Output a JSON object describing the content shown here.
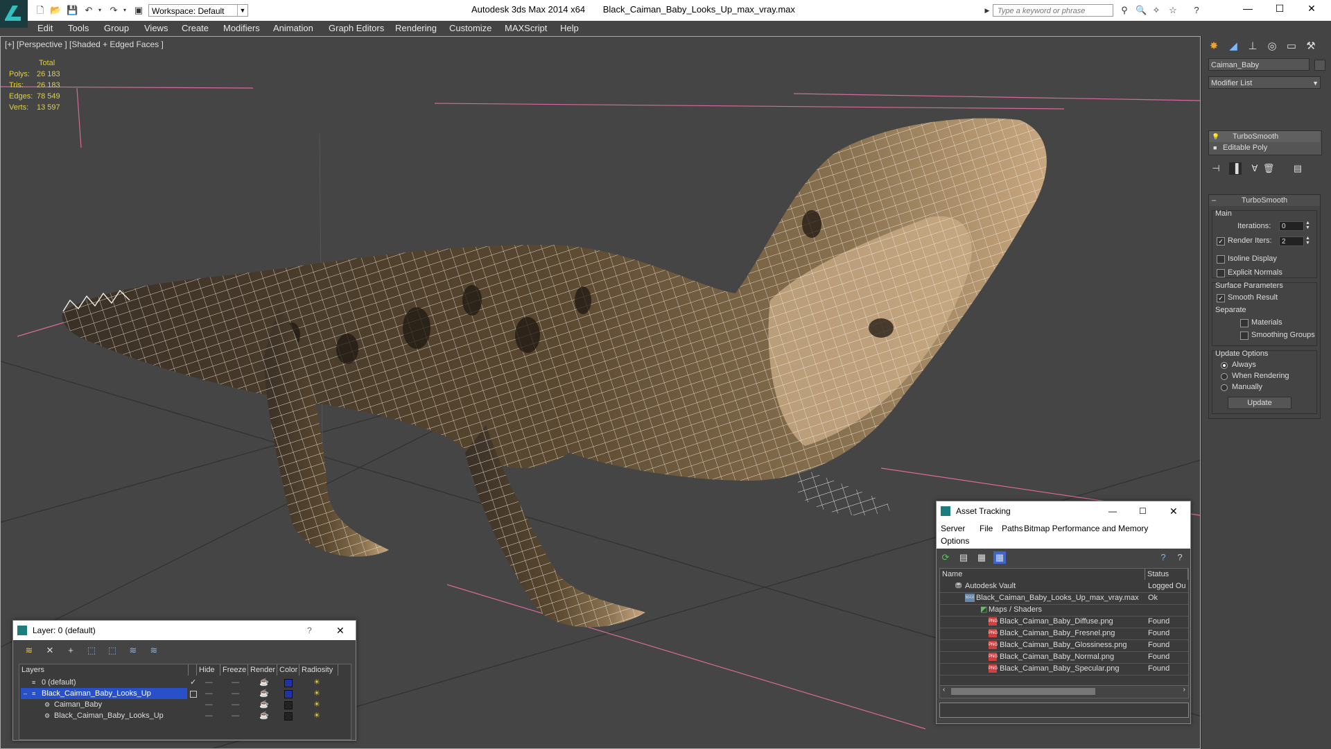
{
  "titlebar": {
    "workspace": "Workspace: Default",
    "app_title": "Autodesk 3ds Max  2014 x64",
    "file_title": "Black_Caiman_Baby_Looks_Up_max_vray.max",
    "search_placeholder": "Type a keyword or phrase"
  },
  "menu": [
    "Edit",
    "Tools",
    "Group",
    "Views",
    "Create",
    "Modifiers",
    "Animation",
    "Graph Editors",
    "Rendering",
    "Customize",
    "MAXScript",
    "Help"
  ],
  "viewport": {
    "label": "[+] [Perspective ] [Shaded + Edged Faces ]",
    "stats": {
      "header": "Total",
      "rows": [
        {
          "label": "Polys:",
          "value": "26 183"
        },
        {
          "label": "Tris:",
          "value": "26 183"
        },
        {
          "label": "Edges:",
          "value": "78 549"
        },
        {
          "label": "Verts:",
          "value": "13 597"
        }
      ]
    }
  },
  "command_panel": {
    "object_name": "Caiman_Baby",
    "modifier_list": "Modifier List",
    "stack": [
      "TurboSmooth",
      "Editable Poly"
    ],
    "rollout_title": "TurboSmooth",
    "main_label": "Main",
    "iterations_label": "Iterations:",
    "iterations_value": "0",
    "render_iters_label": "Render Iters:",
    "render_iters_value": "2",
    "isoline": "Isoline Display",
    "explicit_normals": "Explicit Normals",
    "surface_params": "Surface Parameters",
    "smooth_result": "Smooth Result",
    "separate": "Separate",
    "materials": "Materials",
    "smoothing_groups": "Smoothing Groups",
    "update_options": "Update Options",
    "always": "Always",
    "when_rendering": "When Rendering",
    "manually": "Manually",
    "update_button": "Update"
  },
  "layer_window": {
    "title": "Layer: 0 (default)",
    "help": "?",
    "columns": [
      "Layers",
      "Hide",
      "Freeze",
      "Render",
      "Color",
      "Radiosity"
    ],
    "rows": [
      {
        "name": "0 (default)",
        "indent": 1,
        "color": "#2233aa"
      },
      {
        "name": "Black_Caiman_Baby_Looks_Up",
        "indent": 1,
        "color": "#2233aa",
        "selected": true
      },
      {
        "name": "Caiman_Baby",
        "indent": 2,
        "color": "#222222"
      },
      {
        "name": "Black_Caiman_Baby_Looks_Up",
        "indent": 2,
        "color": "#222222"
      }
    ]
  },
  "asset_window": {
    "title": "Asset Tracking",
    "menu": [
      "Server",
      "File",
      "Paths",
      "Bitmap Performance and Memory",
      "Options"
    ],
    "columns": [
      "Name",
      "Status"
    ],
    "rows": [
      {
        "name": "Autodesk Vault",
        "status": "Logged Ou",
        "indent": 1,
        "icon": "vault"
      },
      {
        "name": "Black_Caiman_Baby_Looks_Up_max_vray.max",
        "status": "Ok",
        "indent": 2,
        "icon": "max"
      },
      {
        "name": "Maps / Shaders",
        "status": "",
        "indent": 3,
        "icon": "maps"
      },
      {
        "name": "Black_Caiman_Baby_Diffuse.png",
        "status": "Found",
        "indent": 4,
        "icon": "png"
      },
      {
        "name": "Black_Caiman_Baby_Fresnel.png",
        "status": "Found",
        "indent": 4,
        "icon": "png"
      },
      {
        "name": "Black_Caiman_Baby_Glossiness.png",
        "status": "Found",
        "indent": 4,
        "icon": "png"
      },
      {
        "name": "Black_Caiman_Baby_Normal.png",
        "status": "Found",
        "indent": 4,
        "icon": "png"
      },
      {
        "name": "Black_Caiman_Baby_Specular.png",
        "status": "Found",
        "indent": 4,
        "icon": "png"
      }
    ]
  }
}
